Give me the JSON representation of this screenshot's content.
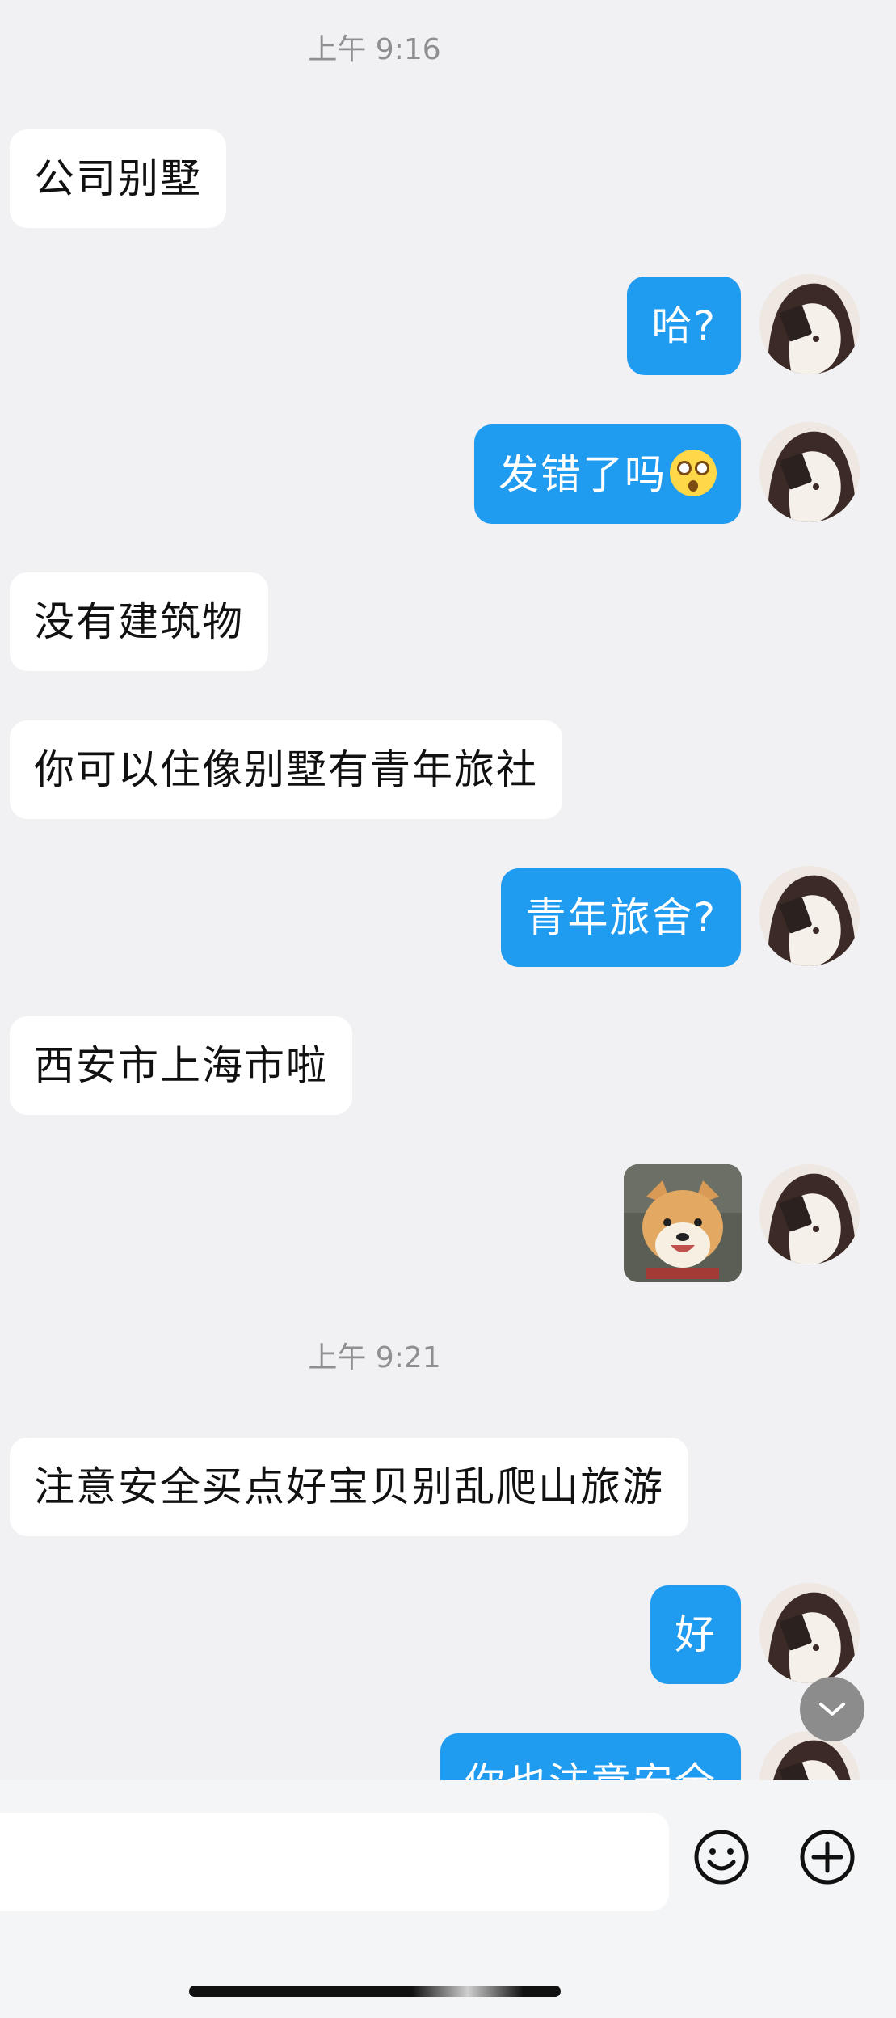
{
  "messages": {
    "time1": "上午 9:16",
    "m1": "公司别墅",
    "m2": "哈?",
    "m3": "发错了吗",
    "m4": "没有建筑物",
    "m5": "你可以住像别墅有青年旅社",
    "m6": "青年旅舍?",
    "m7": "西安市上海市啦",
    "time2": "上午 9:21",
    "m8": "注意安全买点好宝贝别乱爬山旅游",
    "m9": "好",
    "m10": "你也注意安全"
  },
  "icons": {
    "emoji": "astonished-face-icon",
    "sticker": "shiba-dog-sticker",
    "scroll": "chevron-down-icon",
    "smiley": "smiley-icon",
    "plus": "plus-circle-icon"
  },
  "colors": {
    "background": "#f1f1f3",
    "incoming_bubble": "#ffffff",
    "outgoing_bubble": "#1f9bf0",
    "timestamp": "#8e8e93"
  }
}
